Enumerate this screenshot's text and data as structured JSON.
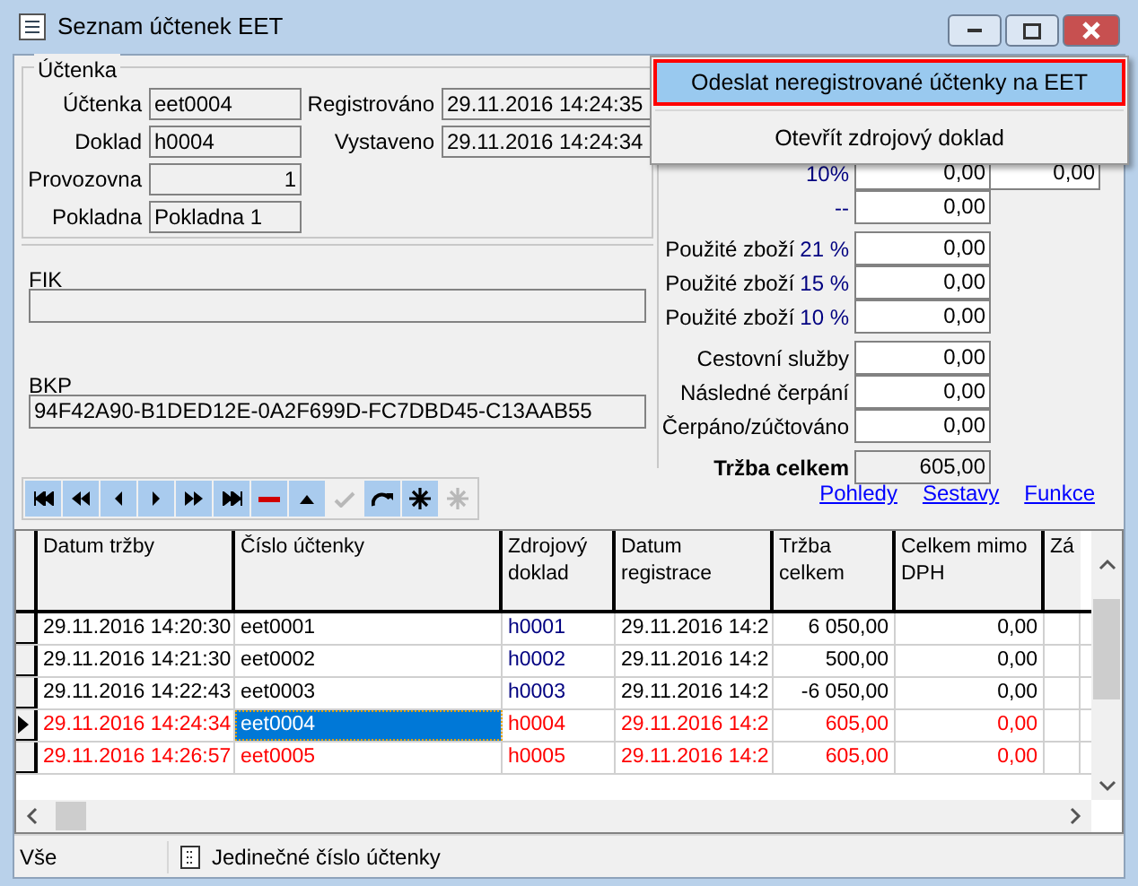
{
  "window": {
    "title": "Seznam účtenek EET"
  },
  "context_menu": [
    {
      "label": "Odeslat neregistrované účtenky na EET",
      "selected": true
    },
    {
      "label": "Otevřít zdrojový doklad",
      "selected": false
    }
  ],
  "receipt": {
    "group_title": "Účtenka",
    "fields": [
      {
        "label": "Účtenka",
        "value": "eet0004",
        "kind": "text"
      },
      {
        "label": "Doklad",
        "value": "h0004",
        "kind": "text"
      },
      {
        "label": "Provozovna",
        "value": "1",
        "kind": "number"
      },
      {
        "label": "Pokladna",
        "value": "Pokladna 1",
        "kind": "text"
      }
    ],
    "dates": [
      {
        "label": "Registrováno",
        "value": "29.11.2016 14:24:35"
      },
      {
        "label": "Vystaveno",
        "value": "29.11.2016 14:24:34"
      }
    ],
    "fik": {
      "label": "FIK"
    },
    "bkp": {
      "label": "BKP",
      "value": "94F42A90-B1DED12E-0A2F699D-FC7DBD45-C13AAB55"
    }
  },
  "amounts": [
    [
      {
        "rate": "10%",
        "values": [
          "0,00",
          "0,00"
        ]
      },
      {
        "rate": "--",
        "values": [
          "0,00"
        ]
      }
    ],
    [
      {
        "label": "Použité zboží",
        "rate": "21 %",
        "values": [
          "0,00"
        ]
      },
      {
        "label": "Použité zboží",
        "rate": "15 %",
        "values": [
          "0,00"
        ]
      },
      {
        "label": "Použité zboží",
        "rate": "10 %",
        "values": [
          "0,00"
        ]
      }
    ],
    [
      {
        "label": "Cestovní služby",
        "values": [
          "0,00"
        ]
      },
      {
        "label": "Následné čerpání",
        "values": [
          "0,00"
        ]
      },
      {
        "label": "Čerpáno/zúčtováno",
        "values": [
          "0,00"
        ]
      }
    ],
    [
      {
        "label": "Tržba celkem",
        "values": [
          "605,00"
        ],
        "total": true
      }
    ]
  ],
  "toolbar": [
    {
      "kind": "first",
      "disabled": false
    },
    {
      "kind": "prev_page",
      "disabled": false
    },
    {
      "kind": "prev",
      "disabled": false
    },
    {
      "kind": "next",
      "disabled": false
    },
    {
      "kind": "next_page",
      "disabled": false
    },
    {
      "kind": "last",
      "disabled": false
    },
    {
      "kind": "delete",
      "disabled": false
    },
    {
      "kind": "up",
      "disabled": false
    },
    {
      "kind": "check",
      "disabled": true
    },
    {
      "kind": "refresh",
      "disabled": false
    },
    {
      "kind": "star",
      "disabled": false
    },
    {
      "kind": "star",
      "disabled": true
    }
  ],
  "links": [
    "Pohledy",
    "Sestavy",
    "Funkce"
  ],
  "table": {
    "columns": [
      "Datum tržby",
      "Číslo účtenky",
      "Zdrojový doklad",
      "Datum registrace",
      "Tržba celkem",
      "Celkem mimo DPH",
      "Zá"
    ],
    "rows": [
      {
        "current": false,
        "registered": true,
        "cells": [
          "29.11.2016 14:20:30",
          "eet0001",
          "h0001",
          "29.11.2016 14:2",
          "6 050,00",
          "0,00"
        ]
      },
      {
        "current": false,
        "registered": true,
        "cells": [
          "29.11.2016 14:21:30",
          "eet0002",
          "h0002",
          "29.11.2016 14:2",
          "500,00",
          "0,00"
        ]
      },
      {
        "current": false,
        "registered": true,
        "cells": [
          "29.11.2016 14:22:43",
          "eet0003",
          "h0003",
          "29.11.2016 14:2",
          "-6 050,00",
          "0,00"
        ]
      },
      {
        "current": true,
        "registered": false,
        "cells": [
          "29.11.2016 14:24:34",
          "eet0004",
          "h0004",
          "29.11.2016 14:2",
          "605,00",
          "0,00"
        ]
      },
      {
        "current": false,
        "registered": false,
        "cells": [
          "29.11.2016 14:26:57",
          "eet0005",
          "h0005",
          "29.11.2016 14:2",
          "605,00",
          "0,00"
        ]
      }
    ]
  },
  "status_bar": {
    "filter": "Vše",
    "hint": "Jedinečné číslo účtenky"
  }
}
